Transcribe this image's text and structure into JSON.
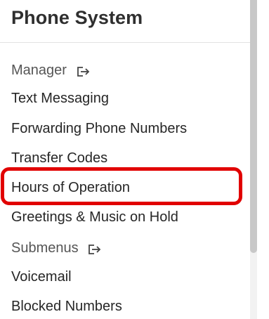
{
  "panel": {
    "title": "Phone System"
  },
  "sections": [
    {
      "label": "Manager",
      "icon": "external-link-icon"
    },
    {
      "label": "Submenus",
      "icon": "external-link-icon"
    }
  ],
  "menu": {
    "text_messaging": "Text Messaging",
    "forwarding_numbers": "Forwarding Phone Numbers",
    "transfer_codes": "Transfer Codes",
    "hours_of_operation": "Hours of Operation",
    "greetings_music": "Greetings & Music on Hold",
    "voicemail": "Voicemail",
    "blocked_numbers": "Blocked Numbers"
  },
  "colors": {
    "highlight": "#e10000",
    "text": "#262626",
    "section_text": "#555555"
  }
}
